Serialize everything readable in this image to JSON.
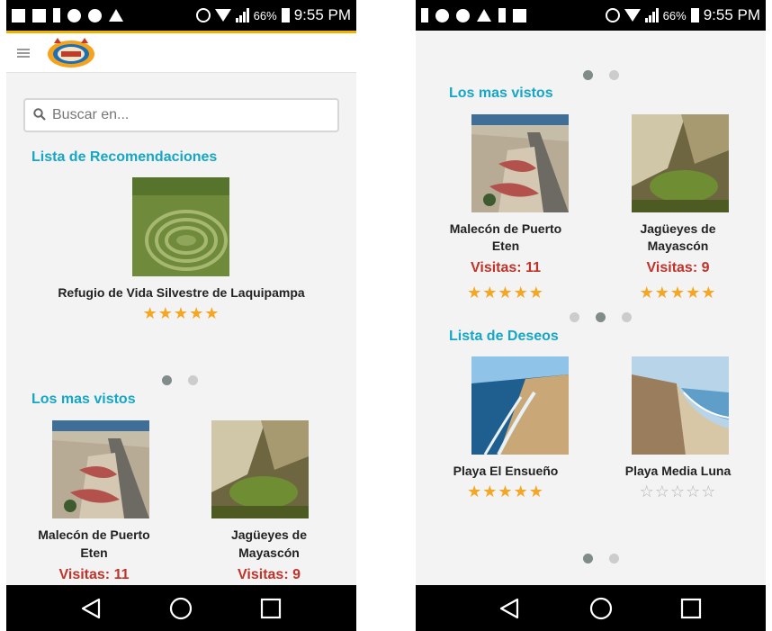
{
  "status_bar": {
    "battery": "66%",
    "time": "9:55 PM"
  },
  "search": {
    "placeholder": "Buscar en..."
  },
  "left": {
    "recommendations_title": "Lista de Recomendaciones",
    "recommendation": {
      "name": "Refugio de Vida Silvestre de Laquipampa",
      "stars": "★★★★★"
    },
    "most_viewed_title": "Los mas vistos",
    "cards": [
      {
        "name_line1": "Malecón de Puerto",
        "name_line2": "Eten",
        "visits": "Visitas: 11"
      },
      {
        "name_line1": "Jagüeyes de",
        "name_line2": "Mayascón",
        "visits": "Visitas: 9"
      }
    ]
  },
  "right": {
    "most_viewed_title": "Los mas vistos",
    "most_viewed": [
      {
        "name_line1": "Malecón de Puerto",
        "name_line2": "Eten",
        "visits": "Visitas: 11",
        "stars": "★★★★★"
      },
      {
        "name_line1": "Jagüeyes de",
        "name_line2": "Mayascón",
        "visits": "Visitas: 9",
        "stars": "★★★★★"
      }
    ],
    "wishlist_title": "Lista de Deseos",
    "wishlist": [
      {
        "name": "Playa El Ensueño",
        "stars": "★★★★★"
      },
      {
        "name": "Playa Media Luna",
        "stars": "☆☆☆☆☆"
      }
    ]
  },
  "colors": {
    "accent": "#16a6c6",
    "visits": "#c0332b",
    "star": "#f5a623",
    "appbar_stripe": "#f0b400"
  },
  "icons": [
    "menu-icon",
    "search-icon",
    "back-icon",
    "home-icon",
    "recents-icon",
    "alarm-icon",
    "wifi-icon",
    "signal-icon",
    "battery-icon"
  ]
}
